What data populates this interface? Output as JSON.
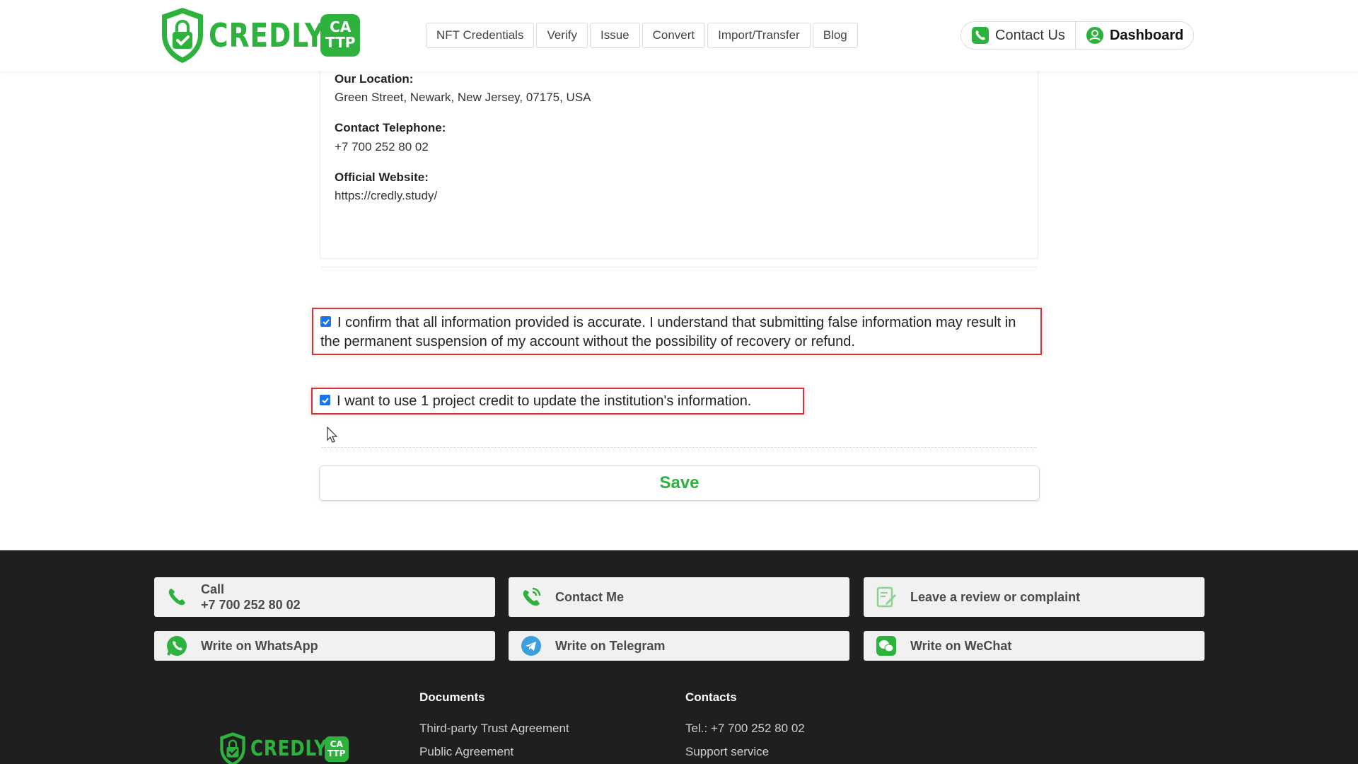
{
  "brand": {
    "name": "CREDLY",
    "badge_line1": "CA",
    "badge_line2": "TTP",
    "accent_color": "#2db33d"
  },
  "nav": {
    "items": [
      {
        "label": "NFT Credentials"
      },
      {
        "label": "Verify"
      },
      {
        "label": "Issue"
      },
      {
        "label": "Convert"
      },
      {
        "label": "Import/Transfer"
      },
      {
        "label": "Blog"
      }
    ]
  },
  "header_actions": {
    "contact_label": "Contact Us",
    "dashboard_label": "Dashboard"
  },
  "info": {
    "location_label": "Our Location:",
    "location_value": "Green Street, Newark, New Jersey, 07175, USA",
    "phone_label": "Contact Telephone:",
    "phone_value": "+7 700 252 80 02",
    "website_label": "Official Website:",
    "website_value": "https://credly.study/"
  },
  "form": {
    "confirm_text": "I confirm that all information provided is accurate. I understand that submitting false information may result in the permanent suspension of my account without the possibility of recovery or refund.",
    "confirm_checked": true,
    "credit_text": "I want to use 1 project credit to update the institution's information.",
    "credit_checked": true,
    "save_label": "Save"
  },
  "footer": {
    "call_label": "Call",
    "call_number": "+7 700 252 80 02",
    "contact_me_label": "Contact Me",
    "review_label": "Leave a review or complaint",
    "whatsapp_label": "Write on WhatsApp",
    "telegram_label": "Write on Telegram",
    "wechat_label": "Write on WeChat",
    "documents_heading": "Documents",
    "documents_links": [
      "Third-party Trust Agreement",
      "Public Agreement"
    ],
    "contacts_heading": "Contacts",
    "contacts_links": [
      "Tel.: +7 700 252 80 02",
      "Support service"
    ]
  }
}
